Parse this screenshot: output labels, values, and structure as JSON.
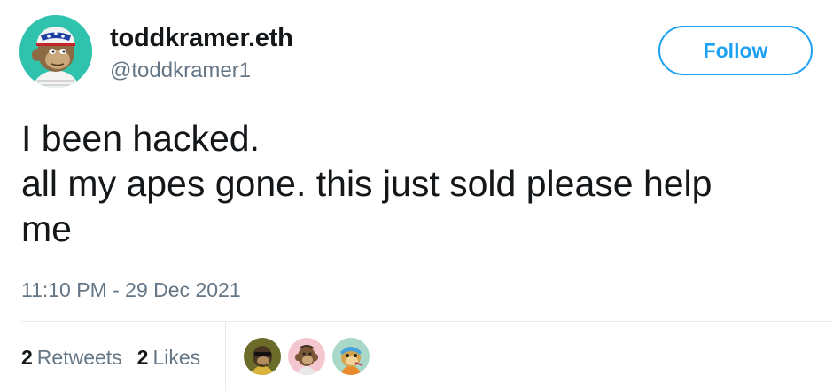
{
  "user": {
    "display_name": "toddkramer.eth",
    "handle": "@toddkramer1",
    "avatar_icon": "bored-ape-avatar-icon"
  },
  "follow_button": {
    "label": "Follow"
  },
  "tweet": {
    "text": "I been hacked.\nall my apes gone. this just sold please help\nme",
    "timestamp": "11:10 PM - 29 Dec 2021"
  },
  "stats": {
    "retweets_count": "2",
    "retweets_label": "Retweets",
    "likes_count": "2",
    "likes_label": "Likes"
  },
  "likers": [
    {
      "icon": "ape-avatar-olive-icon",
      "bg": "#6b6b2a"
    },
    {
      "icon": "ape-avatar-pink-icon",
      "bg": "#f4c6cf"
    },
    {
      "icon": "ape-avatar-teal-icon",
      "bg": "#a9d8c8"
    }
  ],
  "colors": {
    "accent": "#1da1f2",
    "text": "#14171a",
    "muted": "#657786",
    "divider": "#e6ecf0"
  }
}
